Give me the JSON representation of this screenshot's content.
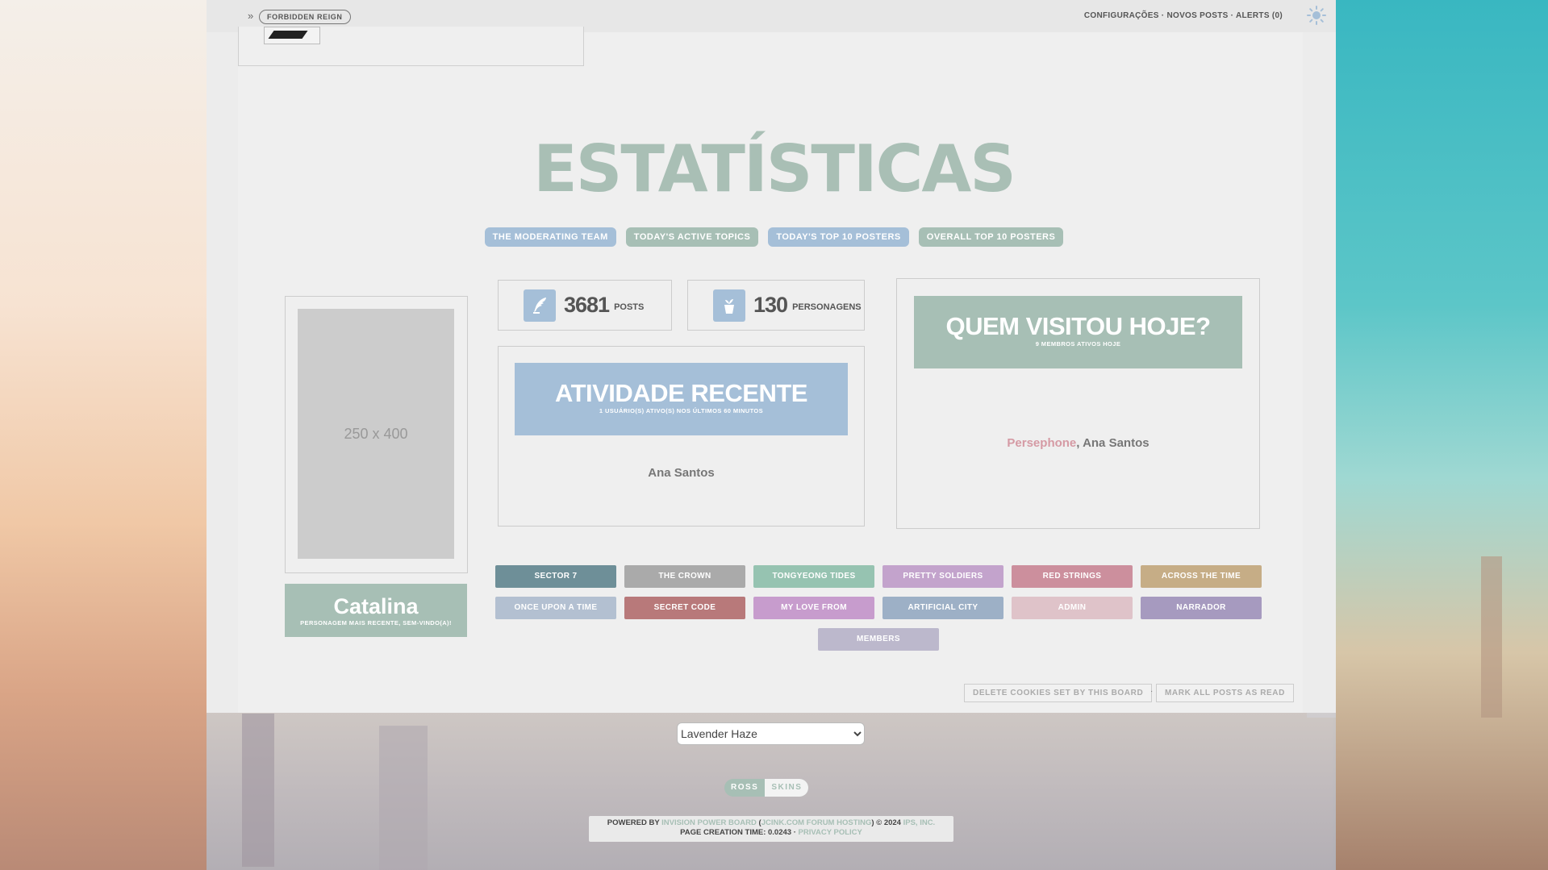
{
  "colors": {
    "mint": "#a7bfb5",
    "blue": "#a5bfd8",
    "text": "#555555",
    "pink_name": "#d59aa4"
  },
  "breadcrumb": {
    "arrow": "»",
    "board": "FORBIDDEN REIGN"
  },
  "topnav": {
    "settings": "CONFIGURAÇÕES",
    "sep1": " · ",
    "new_posts": "NOVOS POSTS",
    "sep2": " · ",
    "alerts": "ALERTS (0)",
    "theme_icon": "sun-icon"
  },
  "stats_title": "ESTATÍSTICAS",
  "tabs": [
    {
      "label": "THE MODERATING TEAM",
      "color": "#a5bfd8"
    },
    {
      "label": "TODAY'S ACTIVE TOPICS",
      "color": "#a7bfb5"
    },
    {
      "label": "TODAY'S TOP 10 POSTERS",
      "color": "#a5bfd8"
    },
    {
      "label": "OVERALL TOP 10 POSTERS",
      "color": "#a7bfb5"
    }
  ],
  "portrait": {
    "placeholder": "250 x 400"
  },
  "newest_member": {
    "name": "Catalina",
    "caption": "PERSONAGEM MAIS RECENTE, SEM-VINDO(A)!"
  },
  "stats": {
    "posts": {
      "value": "3681",
      "label": "POSTS",
      "icon": "quill-icon"
    },
    "characters": {
      "value": "130",
      "label": "PERSONAGENS",
      "icon": "plant-pot-icon"
    }
  },
  "recent_activity": {
    "title": "ATIVIDADE RECENTE",
    "subtitle": "1 USUÁRIO(S) ATIVO(S) NOS ÚLTIMOS 60 MINUTOS",
    "users": "Ana Santos"
  },
  "visited_today": {
    "title": "QUEM VISITOU HOJE?",
    "subtitle": "9 MEMBROS ATIVOS HOJE",
    "user1": "Persephone",
    "separator": ", ",
    "user2": "Ana Santos"
  },
  "groups": [
    {
      "label": "SECTOR 7",
      "color": "#6e8f98"
    },
    {
      "label": "THE CROWN",
      "color": "#aaaaaa"
    },
    {
      "label": "TONGYEONG TIDES",
      "color": "#96c3b1"
    },
    {
      "label": "PRETTY SOLDIERS",
      "color": "#c3a3cc"
    },
    {
      "label": "RED STRINGS",
      "color": "#cc8f9d"
    },
    {
      "label": "ACROSS THE TIME",
      "color": "#c6ad86"
    },
    {
      "label": "ONCE UPON A TIME",
      "color": "#b3c0d1"
    },
    {
      "label": "SECRET CODE",
      "color": "#b8797a"
    },
    {
      "label": "MY LOVE FROM",
      "color": "#c79ccd"
    },
    {
      "label": "ARTIFICIAL CITY",
      "color": "#9db0c6"
    },
    {
      "label": "ADMIN",
      "color": "#dfc3c9"
    },
    {
      "label": "NARRADOR",
      "color": "#a69abf"
    },
    {
      "label": "MEMBERS",
      "color": "#bcb8cc"
    }
  ],
  "footer_links": {
    "delete_cookies": "DELETE COOKIES SET BY THIS BOARD",
    "separator": "·",
    "mark_read": "MARK ALL POSTS AS READ"
  },
  "skin_selector": {
    "selected": "Lavender Haze"
  },
  "credits_badge": {
    "left": "ROSS",
    "right": "SKINS"
  },
  "copyright": {
    "powered_by": "POWERED BY ",
    "ipb": "INVISION POWER BOARD",
    "open": " (",
    "jcink": "JCINK.COM FORUM HOSTING",
    "close_year": ") © 2024 ",
    "ips": "IPS, INC.",
    "page_time": "PAGE CREATION TIME: 0.0243 · ",
    "privacy": "PRIVACY POLICY"
  }
}
